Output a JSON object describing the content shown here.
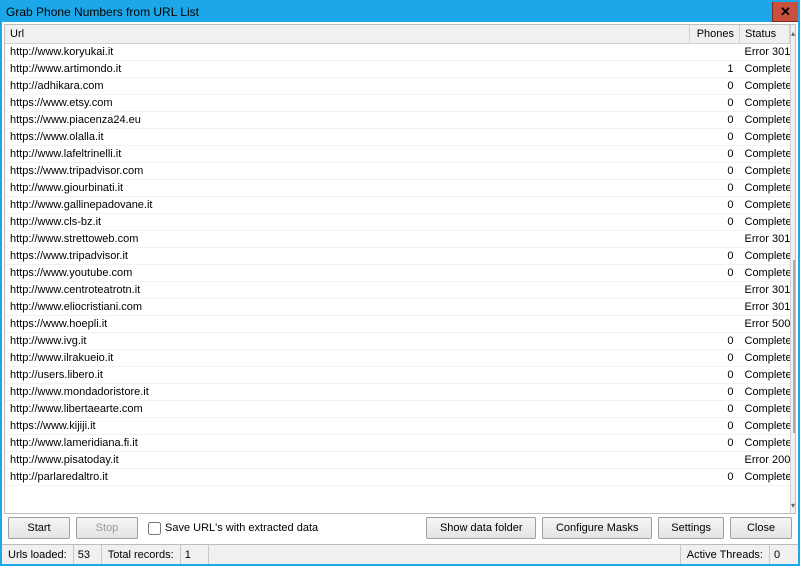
{
  "window": {
    "title": "Grab Phone Numbers from URL List"
  },
  "columns": {
    "url": "Url",
    "phones": "Phones",
    "status": "Status"
  },
  "rows": [
    {
      "url": "http://www.koryukai.it",
      "phones": "",
      "status": "Error 301"
    },
    {
      "url": "http://www.artimondo.it",
      "phones": "1",
      "status": "Complete"
    },
    {
      "url": "http://adhikara.com",
      "phones": "0",
      "status": "Complete"
    },
    {
      "url": "https://www.etsy.com",
      "phones": "0",
      "status": "Complete"
    },
    {
      "url": "https://www.piacenza24.eu",
      "phones": "0",
      "status": "Complete"
    },
    {
      "url": "https://www.olalla.it",
      "phones": "0",
      "status": "Complete"
    },
    {
      "url": "http://www.lafeltrinelli.it",
      "phones": "0",
      "status": "Complete"
    },
    {
      "url": "https://www.tripadvisor.com",
      "phones": "0",
      "status": "Complete"
    },
    {
      "url": "http://www.giourbinati.it",
      "phones": "0",
      "status": "Complete"
    },
    {
      "url": "http://www.gallinepadovane.it",
      "phones": "0",
      "status": "Complete"
    },
    {
      "url": "http://www.cls-bz.it",
      "phones": "0",
      "status": "Complete"
    },
    {
      "url": "http://www.strettoweb.com",
      "phones": "",
      "status": "Error 301"
    },
    {
      "url": "https://www.tripadvisor.it",
      "phones": "0",
      "status": "Complete"
    },
    {
      "url": "https://www.youtube.com",
      "phones": "0",
      "status": "Complete"
    },
    {
      "url": "http://www.centroteatrotn.it",
      "phones": "",
      "status": "Error 301"
    },
    {
      "url": "http://www.eliocristiani.com",
      "phones": "",
      "status": "Error 301"
    },
    {
      "url": "https://www.hoepli.it",
      "phones": "",
      "status": "Error 500"
    },
    {
      "url": "http://www.ivg.it",
      "phones": "0",
      "status": "Complete"
    },
    {
      "url": "http://www.ilrakueio.it",
      "phones": "0",
      "status": "Complete"
    },
    {
      "url": "http://users.libero.it",
      "phones": "0",
      "status": "Complete"
    },
    {
      "url": "http://www.mondadoristore.it",
      "phones": "0",
      "status": "Complete"
    },
    {
      "url": "http://www.libertaearte.com",
      "phones": "0",
      "status": "Complete"
    },
    {
      "url": "https://www.kijiji.it",
      "phones": "0",
      "status": "Complete"
    },
    {
      "url": "http://www.lameridiana.fi.it",
      "phones": "0",
      "status": "Complete"
    },
    {
      "url": "http://www.pisatoday.it",
      "phones": "",
      "status": "Error 200"
    },
    {
      "url": "http://parlaredaltro.it",
      "phones": "0",
      "status": "Complete"
    }
  ],
  "buttons": {
    "start": "Start",
    "stop": "Stop",
    "save_urls": "Save URL's with extracted data",
    "show_folder": "Show data folder",
    "configure_masks": "Configure Masks",
    "settings": "Settings",
    "close": "Close"
  },
  "status": {
    "urls_loaded_label": "Urls loaded:",
    "urls_loaded_value": "53",
    "total_records_label": "Total records:",
    "total_records_value": "1",
    "active_threads_label": "Active Threads:",
    "active_threads_value": "0"
  }
}
